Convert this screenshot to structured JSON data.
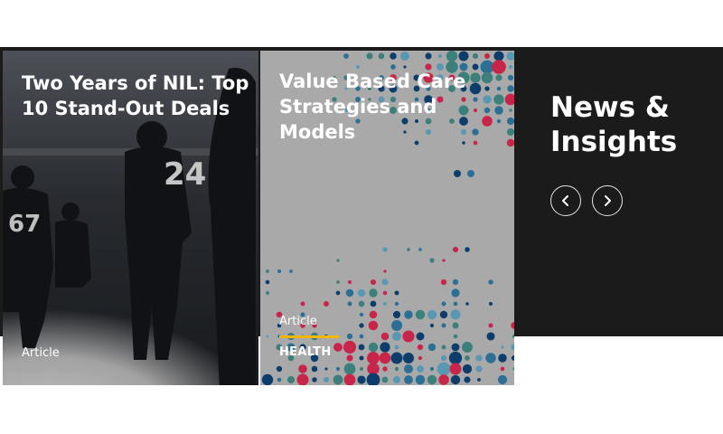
{
  "cards": [
    {
      "title": "Two Years of NIL: Top 10 Stand-Out Deals",
      "type": "Article",
      "image": "football-players-photo"
    },
    {
      "title": "Value Based Care Strategies and Models",
      "type": "Article",
      "tag": "HEALTH",
      "image": "dot-pattern"
    }
  ],
  "section": {
    "title": "News & Insights"
  },
  "carousel": {
    "prev_icon": "chevron-left-icon",
    "next_icon": "chevron-right-icon"
  },
  "colors": {
    "band": "#1b1b1b",
    "accent": "#f2b705",
    "dot_palette": [
      "#0d3d6b",
      "#2b6f94",
      "#3d7f7a",
      "#c8254a",
      "#5a97b3"
    ]
  }
}
